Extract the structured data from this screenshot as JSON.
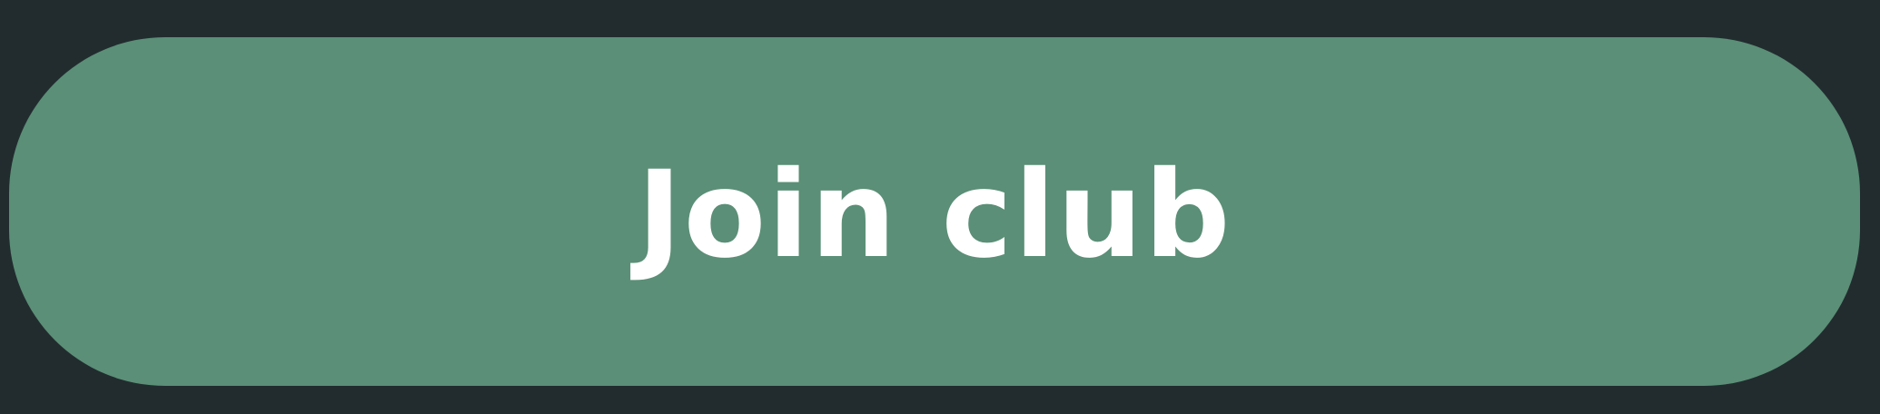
{
  "button": {
    "label": "Join club"
  },
  "colors": {
    "background": "#222c2f",
    "button_fill": "#5b8f77",
    "label_text": "#ffffff"
  }
}
